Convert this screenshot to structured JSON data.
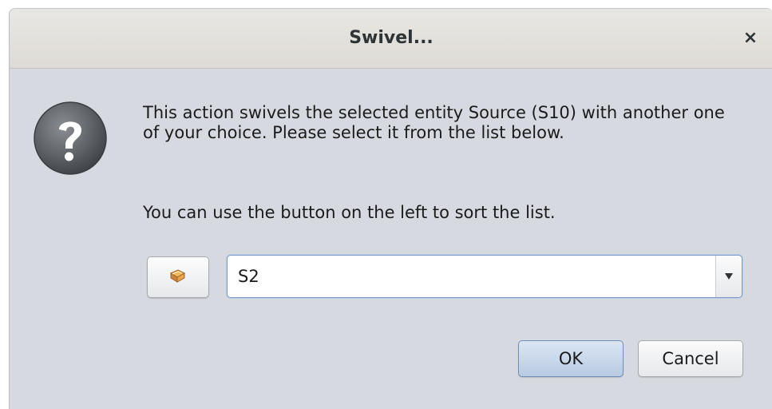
{
  "dialog": {
    "title": "Swivel...",
    "close_glyph": "×",
    "icon": "question-icon",
    "message": "This action swivels the selected entity Source (S10) with another one of your choice. Please select it from the list below.",
    "hint": "You can use the button on the left to sort the list.",
    "sort_button_icon": "book-icon",
    "combo": {
      "selected": "S2"
    },
    "buttons": {
      "ok": "OK",
      "cancel": "Cancel"
    }
  },
  "colors": {
    "accent": "#7c9bc4",
    "ok_button": "#b8cbe2",
    "window_bg": "#d6d9df"
  }
}
